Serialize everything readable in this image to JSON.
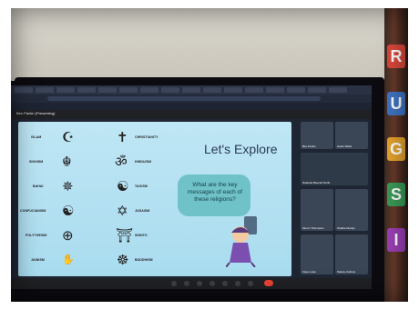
{
  "browser": {
    "presenting_label": "Ben Parkin (Presenting)"
  },
  "slide": {
    "title": "Let's Explore",
    "question": "What are the key messages of each of these religions?",
    "religions_left": [
      {
        "name": "ISLAM",
        "icon": "crescent-icon",
        "glyph": "☪"
      },
      {
        "name": "SIKHISM",
        "icon": "khanda-icon",
        "glyph": "☬"
      },
      {
        "name": "BAHAI",
        "icon": "nine-point-star-icon",
        "glyph": "✵"
      },
      {
        "name": "CONFUCIANISM",
        "icon": "confucian-symbol-icon",
        "glyph": "☯"
      },
      {
        "name": "POLYTHEISM",
        "icon": "circle-cross-icon",
        "glyph": "⊕"
      },
      {
        "name": "JAINISM",
        "icon": "jain-hand-icon",
        "glyph": "✋"
      }
    ],
    "religions_right": [
      {
        "name": "CHRISTIANITY",
        "icon": "cross-icon",
        "glyph": "✝"
      },
      {
        "name": "HINDUISM",
        "icon": "om-icon",
        "glyph": "ॐ"
      },
      {
        "name": "TAOISM",
        "icon": "yin-yang-icon",
        "glyph": "☯"
      },
      {
        "name": "JUDAISM",
        "icon": "star-of-david-icon",
        "glyph": "✡"
      },
      {
        "name": "SHINTO",
        "icon": "torii-icon",
        "glyph": "⛩"
      },
      {
        "name": "BUDDHISM",
        "icon": "dharma-wheel-icon",
        "glyph": "☸"
      }
    ]
  },
  "participants": [
    {
      "name": "Ben Parkin"
    },
    {
      "name": "Helen Watts"
    },
    {
      "name": "Natasha Baynell Smith"
    },
    {
      "name": "Simon Thompson"
    },
    {
      "name": "Charlie Dunley"
    },
    {
      "name": "Faye Lowe"
    },
    {
      "name": "Stacey Andrew"
    }
  ],
  "wall_border_letters": [
    "R",
    "U",
    "G",
    "S",
    "I"
  ],
  "colors": {
    "slide_bg": "#bfe6f5",
    "bubble": "#6fc2c8",
    "leave_button": "#ea4335"
  }
}
